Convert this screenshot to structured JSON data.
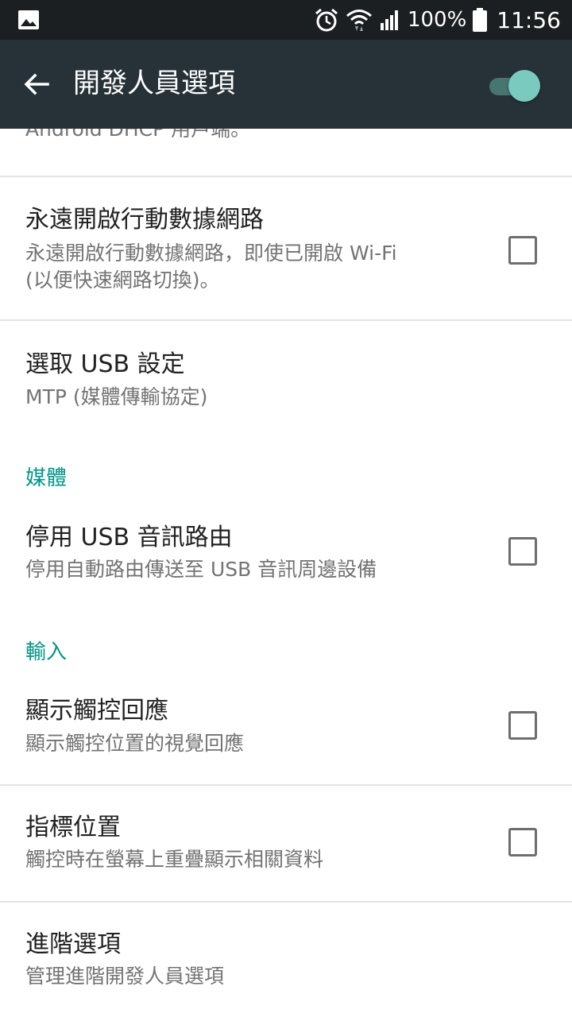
{
  "status_bar": {
    "battery": "100%",
    "time": "11:56"
  },
  "toolbar": {
    "title": "開發人員選項",
    "master_switch_on": true
  },
  "settings": {
    "dhcp_summary": "Android DHCP 用戶端。",
    "always_on_data": {
      "title": "永遠開啟行動數據網路",
      "summary_line1": "永遠開啟行動數據網路，即使已開啟 Wi-Fi",
      "summary_line2": "(以便快速網路切換)。",
      "checked": false
    },
    "usb_config": {
      "title": "選取 USB 設定",
      "summary": "MTP (媒體傳輸協定)"
    },
    "media_category": "媒體",
    "usb_audio": {
      "title": "停用 USB 音訊路由",
      "summary": "停用自動路由傳送至 USB 音訊周邊設備",
      "checked": false
    },
    "input_category": "輸入",
    "show_touches": {
      "title": "顯示觸控回應",
      "summary": "顯示觸控位置的視覺回應",
      "checked": false
    },
    "pointer_location": {
      "title": "指標位置",
      "summary": "觸控時在螢幕上重疊顯示相關資料",
      "checked": false
    },
    "advanced": {
      "title": "進階選項",
      "summary": "管理進階開發人員選項"
    }
  }
}
